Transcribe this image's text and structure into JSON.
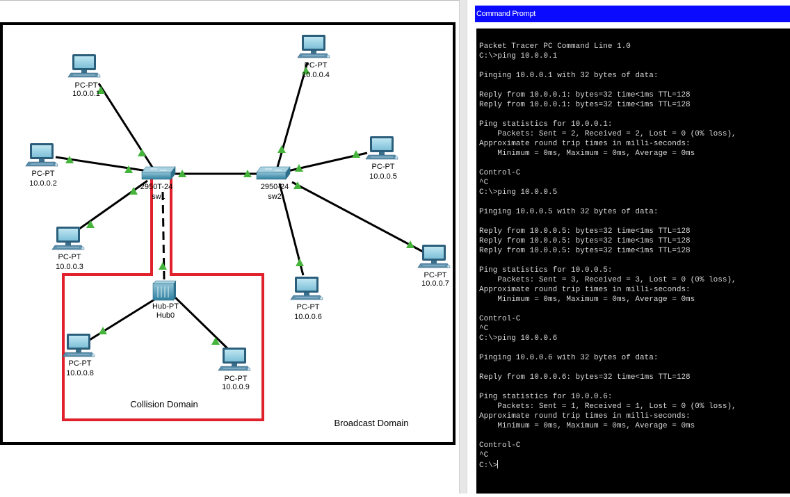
{
  "topology": {
    "devices": [
      {
        "id": "pc1",
        "model": "PC-PT",
        "ip": "10.0.0.1"
      },
      {
        "id": "pc2",
        "model": "PC-PT",
        "ip": "10.0.0.2"
      },
      {
        "id": "pc3",
        "model": "PC-PT",
        "ip": "10.0.0.3"
      },
      {
        "id": "pc4",
        "model": "PC-PT",
        "ip": "10.0.0.4"
      },
      {
        "id": "pc5",
        "model": "PC-PT",
        "ip": "10.0.0.5"
      },
      {
        "id": "pc6",
        "model": "PC-PT",
        "ip": "10.0.0.6"
      },
      {
        "id": "pc7",
        "model": "PC-PT",
        "ip": "10.0.0.7"
      },
      {
        "id": "pc8",
        "model": "PC-PT",
        "ip": "10.0.0.8"
      },
      {
        "id": "pc9",
        "model": "PC-PT",
        "ip": "10.0.0.9"
      }
    ],
    "switches": [
      {
        "id": "sw1",
        "model": "2950T-24",
        "name": "sw1"
      },
      {
        "id": "sw2",
        "model": "2950-24",
        "name": "sw2"
      }
    ],
    "hub": {
      "model": "Hub-PT",
      "name": "Hub0"
    },
    "annotations": {
      "collision_domain": "Collision Domain",
      "broadcast_domain": "Broadcast Domain"
    },
    "colors": {
      "link": "#000000",
      "link_status": "#46b43c",
      "collision_box": "#e0202a",
      "frame": "#000000"
    }
  },
  "command_prompt": {
    "title": "Command Prompt",
    "output": "Packet Tracer PC Command Line 1.0\nC:\\>ping 10.0.0.1\n\nPinging 10.0.0.1 with 32 bytes of data:\n\nReply from 10.0.0.1: bytes=32 time<1ms TTL=128\nReply from 10.0.0.1: bytes=32 time<1ms TTL=128\n\nPing statistics for 10.0.0.1:\n    Packets: Sent = 2, Received = 2, Lost = 0 (0% loss),\nApproximate round trip times in milli-seconds:\n    Minimum = 0ms, Maximum = 0ms, Average = 0ms\n\nControl-C\n^C\nC:\\>ping 10.0.0.5\n\nPinging 10.0.0.5 with 32 bytes of data:\n\nReply from 10.0.0.5: bytes=32 time<1ms TTL=128\nReply from 10.0.0.5: bytes=32 time<1ms TTL=128\nReply from 10.0.0.5: bytes=32 time<1ms TTL=128\n\nPing statistics for 10.0.0.5:\n    Packets: Sent = 3, Received = 3, Lost = 0 (0% loss),\nApproximate round trip times in milli-seconds:\n    Minimum = 0ms, Maximum = 0ms, Average = 0ms\n\nControl-C\n^C\nC:\\>ping 10.0.0.6\n\nPinging 10.0.0.6 with 32 bytes of data:\n\nReply from 10.0.0.6: bytes=32 time<1ms TTL=128\n\nPing statistics for 10.0.0.6:\n    Packets: Sent = 1, Received = 1, Lost = 0 (0% loss),\nApproximate round trip times in milli-seconds:\n    Minimum = 0ms, Maximum = 0ms, Average = 0ms\n\nControl-C\n^C\nC:\\>"
  }
}
